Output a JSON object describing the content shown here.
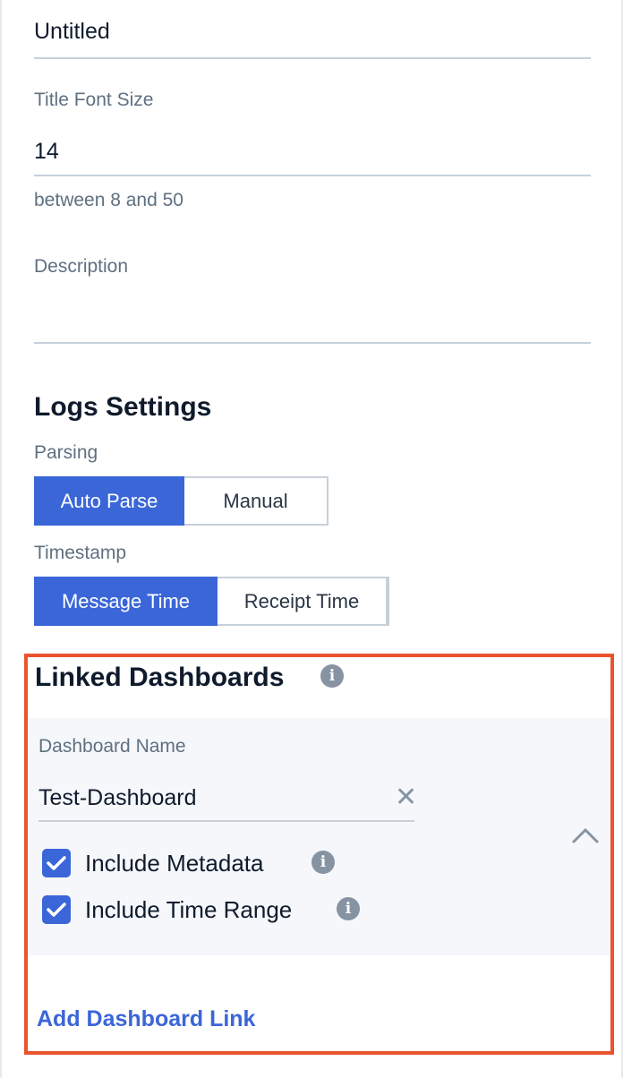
{
  "title_field": {
    "value": "Untitled"
  },
  "title_font_size": {
    "label": "Title Font Size",
    "value": "14",
    "hint": "between 8 and 50"
  },
  "description": {
    "label": "Description",
    "value": ""
  },
  "logs_settings": {
    "title": "Logs Settings",
    "parsing": {
      "label": "Parsing",
      "options": [
        "Auto Parse",
        "Manual"
      ],
      "selected": "Auto Parse"
    },
    "timestamp": {
      "label": "Timestamp",
      "options": [
        "Message Time",
        "Receipt Time"
      ],
      "selected": "Message Time"
    }
  },
  "linked_dashboards": {
    "title": "Linked Dashboards",
    "info_icon": "info-icon",
    "dashboard": {
      "name_label": "Dashboard Name",
      "name_value": "Test-Dashboard",
      "include_metadata": {
        "label": "Include Metadata",
        "checked": true
      },
      "include_time_range": {
        "label": "Include Time Range",
        "checked": true
      }
    },
    "add_link_label": "Add Dashboard Link"
  },
  "colors": {
    "accent": "#3a66d8",
    "highlight_border": "#e9542f",
    "muted_text": "#5f7080"
  }
}
